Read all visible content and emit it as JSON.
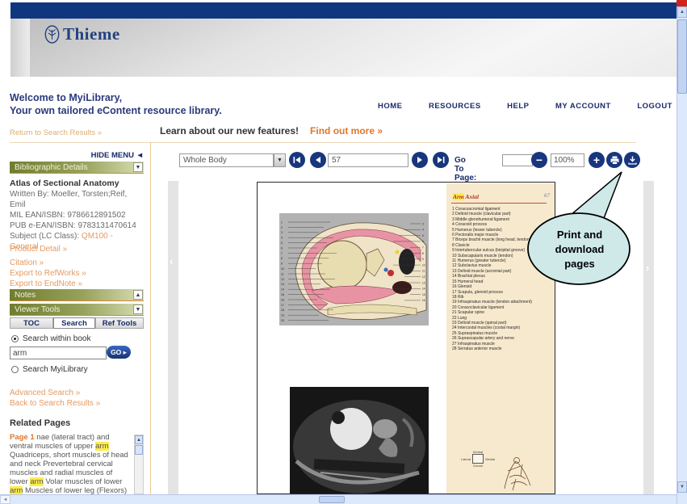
{
  "brand": {
    "name": "Thieme"
  },
  "nav": {
    "items": [
      "HOME",
      "RESOURCES",
      "HELP",
      "MY ACCOUNT",
      "LOGOUT"
    ]
  },
  "welcome": {
    "line1": "Welcome to MyiLibrary,",
    "line2": "Your own tailored eContent resource library."
  },
  "subheader": {
    "return_link": "Return to Search Results »",
    "features_text": "Learn about our new features!",
    "find_out_more": "Find out more »"
  },
  "sidebar": {
    "hide_menu": "HIDE MENU",
    "biblio_header": "Bibliographic Details",
    "book": {
      "title": "Atlas of Sectional Anatomy",
      "written_by": "Written By: Moeller, Torsten;Reif, Emil",
      "mil_ean": "MIL EAN/ISBN: 9786612891502",
      "pub_ean": "PUB e-EAN/ISBN: 9783131470614",
      "subject_label": "Subject (LC Class):",
      "subject_code": "QM100",
      "subject_sep": "-",
      "subject_value": "General"
    },
    "links": {
      "product_detail": "Product Detail »",
      "citation": "Citation »",
      "refworks": "Export to RefWorks »",
      "endnote": "Export to EndNote »",
      "advanced_search": "Advanced Search »",
      "back_to_results": "Back to Search Results »"
    },
    "notes_header": "Notes",
    "viewer_tools_header": "Viewer Tools",
    "tabs": [
      "TOC",
      "Search",
      "Ref Tools"
    ],
    "search": {
      "within_book_label": "Search within book",
      "query": "arm",
      "go_label": "GO",
      "my_library_label": "Search MyiLibrary"
    },
    "related": {
      "heading": "Related Pages",
      "segments": [
        {
          "type": "link",
          "text": "Page 1"
        },
        {
          "type": "text",
          "text": " nae (lateral tract) and ventral muscles of upper "
        },
        {
          "type": "hl",
          "text": "arm"
        },
        {
          "type": "text",
          "text": " Quadriceps, short muscles of head and neck Prevertebral cervical muscles and radial muscles of lower "
        },
        {
          "type": "hl",
          "text": "arm"
        },
        {
          "type": "text",
          "text": " Volar muscles of lower "
        },
        {
          "type": "hl",
          "text": "arm"
        },
        {
          "type": "text",
          "text": " Muscles of lower leg (Flexors) Trunk, shoulder girdle"
        }
      ]
    }
  },
  "toolbar": {
    "section_value": "Whole Body",
    "page_value": "57",
    "goto_label": "Go To Page:",
    "zoom_value": "100%"
  },
  "callout": {
    "text": "Print and download pages"
  },
  "book_page": {
    "header_term": "Arm",
    "header_rest": " Axial",
    "page_number": "67",
    "list": [
      "Coracoacromial ligament",
      "Deltoid muscle (clavicular part)",
      "Middle glenohumeral ligament",
      "Coracoid process",
      "Humerus (lesser tubercle)",
      "Pectoralis major muscle",
      "Biceps brachii muscle (long head, tendon)",
      "Clavicle",
      "Intertubercular sulcus (bicipital groove)",
      "Subscapularis muscle (tendon)",
      "Humerus (greater tubercle)",
      "Subclavius muscle",
      "Deltoid muscle (acromial part)",
      "Brachial plexus",
      "Humeral head",
      "Glenoid",
      "Scapula, glenoid process",
      "Rib",
      "Infraspinatus muscle (tendon attachment)",
      "Coracoclavicular ligament",
      "Scapular spine",
      "Lung",
      "Deltoid muscle (spinal part)",
      "Intercostal muscles (costal margin)",
      "Supraspinatus muscle",
      "Suprascapular artery and nerve",
      "Infraspinatus muscle",
      "Serratus anterior muscle"
    ],
    "orientation": {
      "top": "Ventral",
      "left": "Lateral",
      "right": "Medial",
      "bottom": "Dorsal"
    }
  }
}
